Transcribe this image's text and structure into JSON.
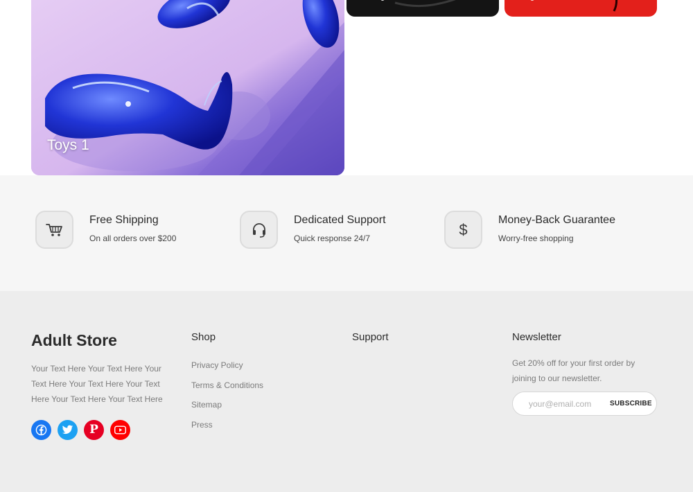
{
  "categories": [
    {
      "label": "Toys 1"
    }
  ],
  "features": [
    {
      "title": "Free Shipping",
      "subtitle": "On all orders over $200",
      "icon": "cart-icon"
    },
    {
      "title": "Dedicated Support",
      "subtitle": "Quick response 24/7",
      "icon": "headset-icon"
    },
    {
      "title": "Money-Back Guarantee",
      "subtitle": "Worry-free shopping",
      "icon": "dollar-icon"
    }
  ],
  "footer": {
    "brand": "Adult Store",
    "brand_text": "Your Text Here Your Text Here Your Text Here Your Text Here Your Text Here Your Text Here Your Text Here",
    "socials": [
      {
        "icon": "facebook-icon",
        "color": "#1877f2"
      },
      {
        "icon": "twitter-icon",
        "color": "#1da1f2"
      },
      {
        "icon": "pinterest-icon",
        "color": "#e60023"
      },
      {
        "icon": "youtube-icon",
        "color": "#ff0000"
      }
    ],
    "shop": {
      "title": "Shop",
      "links": [
        "Privacy Policy",
        "Terms & Conditions",
        "Sitemap",
        "Press"
      ]
    },
    "support": {
      "title": "Support"
    },
    "newsletter": {
      "title": "Newsletter",
      "text": "Get 20% off for your first order by joining to our newsletter.",
      "placeholder": "your@email.com",
      "button": "SUBSCRIBE"
    }
  }
}
